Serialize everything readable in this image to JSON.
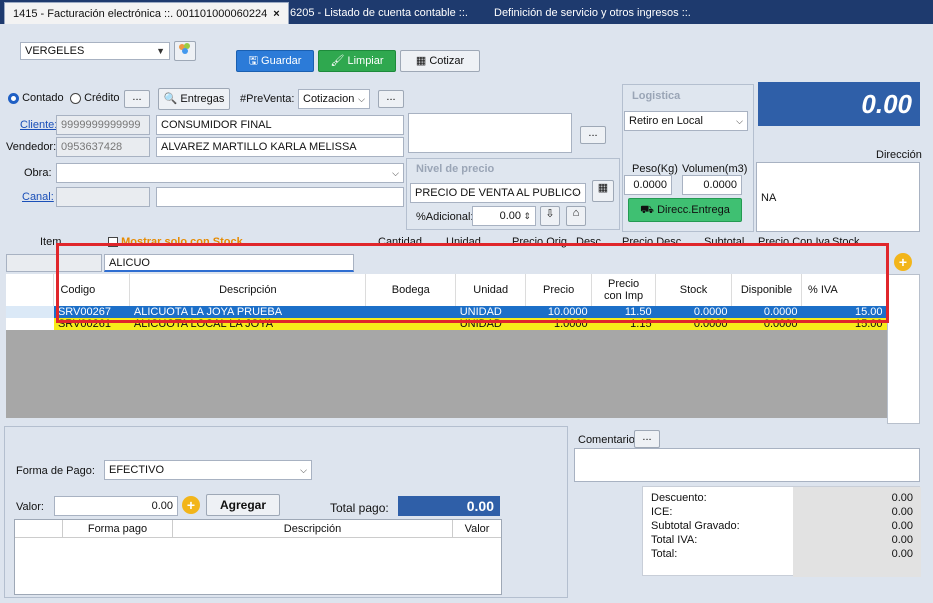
{
  "tabs": [
    {
      "label": "1415 - Facturación electrónica ::. 001101000060224",
      "close": "×",
      "active": true
    },
    {
      "label": "6205 - Listado de cuenta contable ::.",
      "active": false
    },
    {
      "label": "Definición de servicio y otros ingresos ::.",
      "active": false
    }
  ],
  "toolbar": {
    "branch": "VERGELES",
    "save": "Guardar",
    "clear": "Limpiar",
    "quote": "Cotizar"
  },
  "payment_type": {
    "cash": "Contado",
    "credit": "Crédito",
    "dots": "..."
  },
  "entregas": "Entregas",
  "preventa": {
    "label": "#PreVenta:",
    "value": "Cotizacion",
    "dots": "..."
  },
  "cliente": {
    "label": "Cliente:",
    "id": "9999999999999",
    "name": "CONSUMIDOR FINAL"
  },
  "vendedor": {
    "label": "Vendedor:",
    "id": "0953637428",
    "name": "ALVAREZ MARTILLO KARLA MELISSA"
  },
  "obra": {
    "label": "Obra:"
  },
  "canal": {
    "label": "Canal:"
  },
  "nivel_precio": {
    "title": "Nivel de precio",
    "value": "PRECIO DE VENTA AL PUBLICO",
    "adicional_label": "%Adicional:",
    "adicional_value": "0.00"
  },
  "logistica": {
    "title": "Logistica",
    "value": "Retiro en Local",
    "peso_label": "Peso(Kg)",
    "volumen_label": "Volumen(m3)",
    "peso_value": "0.0000",
    "volumen_value": "0.0000",
    "direcc_button": "Direcc.Entrega"
  },
  "total_display": "0.00",
  "direccion": {
    "label": "Dirección",
    "value": "NA"
  },
  "items_header": {
    "item": "Item",
    "show_stock": "Mostrar solo con Stock",
    "cantidad": "Cantidad",
    "unidad": "Unidad",
    "precio_orig": "Precio Orig.",
    "desc": "Desc.",
    "precio_desc": "Precio Desc",
    "subtotal": "Subtotal",
    "precio_con_iva": "Precio Con Iva",
    "stock": "Stock"
  },
  "search": {
    "value": "ALICUO"
  },
  "grid": {
    "columns": [
      "Codigo",
      "Descripción",
      "Bodega",
      "Unidad",
      "Precio",
      "Precio con Imp",
      "Stock",
      "Disponible",
      "% IVA"
    ],
    "rows": [
      {
        "codigo": "SRV00267",
        "descripcion": "ALICUOTA LA JOYA PRUEBA",
        "bodega": "",
        "unidad": "UNIDAD",
        "precio": "10.0000",
        "precio_imp": "11.50",
        "stock": "0.0000",
        "disponible": "0.0000",
        "iva": "15.00"
      },
      {
        "codigo": "SRV00261",
        "descripcion": "ALICUOTA LOCAL LA JOYA",
        "bodega": "",
        "unidad": "UNIDAD",
        "precio": "1.0000",
        "precio_imp": "1.15",
        "stock": "0.0000",
        "disponible": "0.0000",
        "iva": "15.00"
      }
    ]
  },
  "forma_pago": {
    "label": "Forma de Pago:",
    "value": "EFECTIVO"
  },
  "valor": {
    "label": "Valor:",
    "value": "0.00",
    "add": "Agregar",
    "total_label": "Total pago:",
    "total_value": "0.00"
  },
  "pay_table": {
    "columns": [
      "Forma pago",
      "Descripción",
      "Valor"
    ]
  },
  "comentario": {
    "label": "Comentario:",
    "dots": "..."
  },
  "totals": [
    {
      "label": "Descuento:",
      "value": "0.00"
    },
    {
      "label": "ICE:",
      "value": "0.00"
    },
    {
      "label": "Subtotal Gravado:",
      "value": "0.00"
    },
    {
      "label": "Total IVA:",
      "value": "0.00"
    },
    {
      "label": "Total:",
      "value": "0.00"
    }
  ],
  "colors": {
    "accent": "#1e3a6e",
    "selected_row": "#1c6fc8",
    "highlight_row": "#f7ec1a",
    "highlight_box": "#e0262b",
    "total_bg": "#2f5fa8"
  }
}
